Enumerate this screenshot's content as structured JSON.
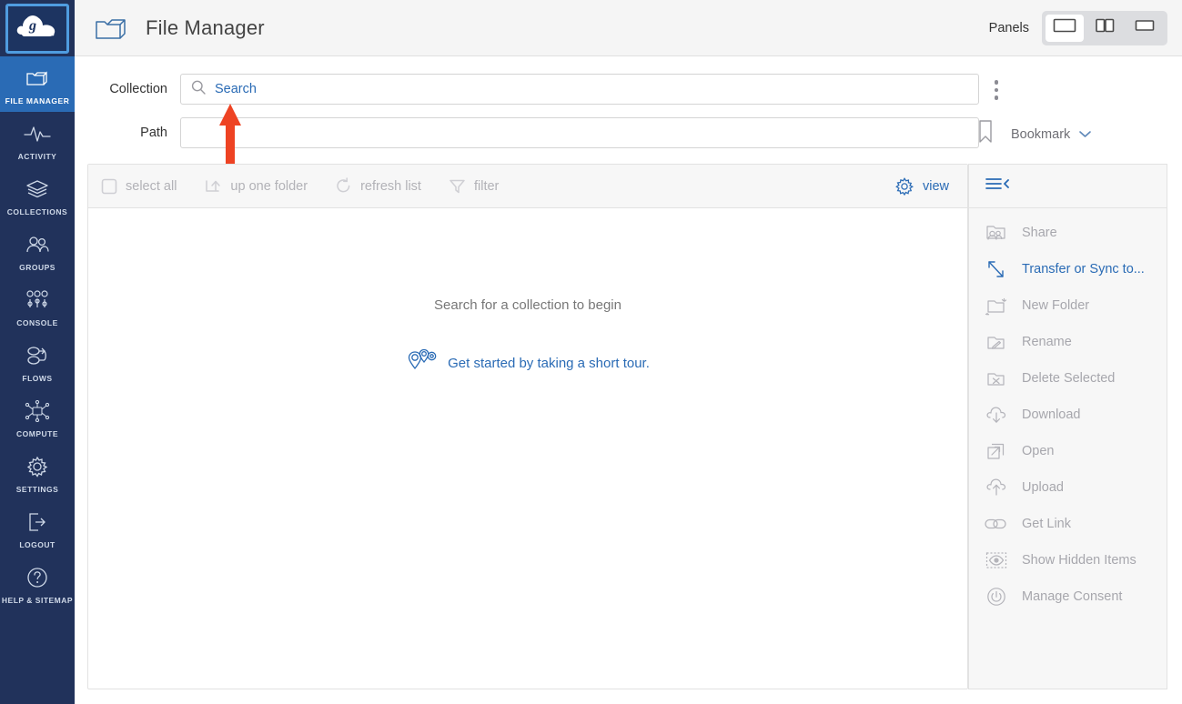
{
  "header": {
    "title": "File Manager",
    "folder_icon": "folder-icon",
    "panels_label": "Panels",
    "panel_buttons": [
      {
        "name": "panel-single",
        "icon": "single-panel-icon",
        "selected": true
      },
      {
        "name": "panel-split",
        "icon": "two-panel-icon",
        "selected": false
      },
      {
        "name": "panel-wide",
        "icon": "wide-panel-icon",
        "selected": false
      }
    ]
  },
  "sidebar": {
    "logo": "globus-logo",
    "items": [
      {
        "label": "FILE MANAGER",
        "icon": "folder-icon",
        "active": true
      },
      {
        "label": "ACTIVITY",
        "icon": "activity-pulse-icon",
        "active": false
      },
      {
        "label": "COLLECTIONS",
        "icon": "layers-icon",
        "active": false
      },
      {
        "label": "GROUPS",
        "icon": "people-icon",
        "active": false
      },
      {
        "label": "CONSOLE",
        "icon": "sliders-icon",
        "active": false
      },
      {
        "label": "FLOWS",
        "icon": "flow-nodes-icon",
        "active": false
      },
      {
        "label": "COMPUTE",
        "icon": "compute-chip-icon",
        "active": false
      },
      {
        "label": "SETTINGS",
        "icon": "gear-icon",
        "active": false
      },
      {
        "label": "LOGOUT",
        "icon": "logout-arrow-icon",
        "active": false
      },
      {
        "label": "HELP & SITEMAP",
        "icon": "question-circle-icon",
        "active": false
      }
    ]
  },
  "form": {
    "collection_label": "Collection",
    "collection_value": "Search",
    "collection_placeholder": "Search",
    "search_icon": "magnifier-icon",
    "path_label": "Path",
    "path_value": "",
    "path_placeholder": "",
    "kebab_icon": "vertical-dots-icon",
    "bookmark_label": "Bookmark",
    "bookmark_icon": "bookmark-ribbon-icon",
    "bookmark_chevron": "chevron-down-icon"
  },
  "toolbar": {
    "items": [
      {
        "label": "select all",
        "icon": "checkbox-icon",
        "enabled": false
      },
      {
        "label": "up one folder",
        "icon": "up-arrow-icon",
        "enabled": false
      },
      {
        "label": "refresh list",
        "icon": "refresh-icon",
        "enabled": false
      },
      {
        "label": "filter",
        "icon": "funnel-icon",
        "enabled": false
      }
    ],
    "view_label": "view",
    "view_icon": "gear-icon"
  },
  "file_list": {
    "empty_message": "Search for a collection to begin",
    "tour_link": "Get started by taking a short tour.",
    "tour_icon": "map-pins-icon"
  },
  "right_panel": {
    "collapse_icon": "hamburger-collapse-icon",
    "actions": [
      {
        "label": "Share",
        "icon": "share-people-icon",
        "enabled": false
      },
      {
        "label": "Transfer or Sync to...",
        "icon": "transfer-arrows-icon",
        "enabled": true
      },
      {
        "label": "New Folder",
        "icon": "new-folder-icon",
        "enabled": false
      },
      {
        "label": "Rename",
        "icon": "rename-pencil-icon",
        "enabled": false
      },
      {
        "label": "Delete Selected",
        "icon": "delete-x-icon",
        "enabled": false
      },
      {
        "label": "Download",
        "icon": "download-cloud-icon",
        "enabled": false
      },
      {
        "label": "Open",
        "icon": "open-external-icon",
        "enabled": false
      },
      {
        "label": "Upload",
        "icon": "upload-cloud-icon",
        "enabled": false
      },
      {
        "label": "Get Link",
        "icon": "link-chain-icon",
        "enabled": false
      },
      {
        "label": "Show Hidden Items",
        "icon": "eye-dashed-icon",
        "enabled": false
      },
      {
        "label": "Manage Consent",
        "icon": "power-circle-icon",
        "enabled": false
      }
    ]
  },
  "annotation": {
    "arrow_color": "#ee4323",
    "points_at": "collection-search-input"
  },
  "colors": {
    "sidebar_bg": "#21325b",
    "sidebar_active": "#2a6bb5",
    "accent_blue": "#2a6bb5",
    "header_bg": "#f5f5f5",
    "panel_bg": "#f7f7f7",
    "disabled_text": "#a7a7ad"
  }
}
